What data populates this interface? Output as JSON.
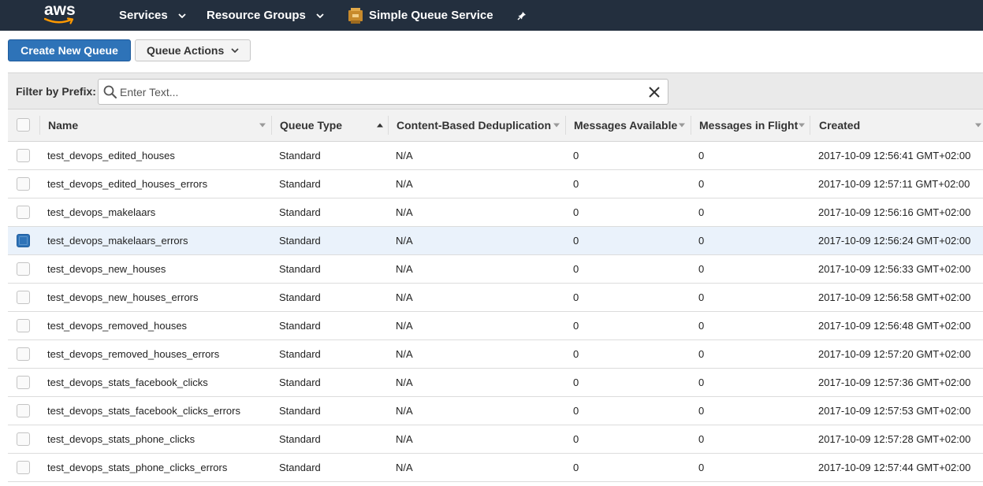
{
  "nav": {
    "logo": "aws",
    "services": "Services",
    "resource_groups": "Resource Groups",
    "service_name": "Simple Queue Service",
    "service_icon": "sqs-icon",
    "pin_icon": "pin-icon",
    "bg_color": "#232f3e"
  },
  "toolbar": {
    "create_label": "Create New Queue",
    "actions_label": "Queue Actions",
    "primary_color": "#2e73b8"
  },
  "filter": {
    "label": "Filter by Prefix:",
    "placeholder": "Enter Text...",
    "value": ""
  },
  "table": {
    "columns": [
      "Name",
      "Queue Type",
      "Content-Based Deduplication",
      "Messages Available",
      "Messages in Flight",
      "Created"
    ],
    "sorted_column": "Queue Type",
    "sort_direction": "ascending",
    "rows": [
      {
        "name": "test_devops_edited_houses",
        "type": "Standard",
        "dedup": "N/A",
        "available": "0",
        "in_flight": "0",
        "created": "2017-10-09 12:56:41 GMT+02:00",
        "selected": false
      },
      {
        "name": "test_devops_edited_houses_errors",
        "type": "Standard",
        "dedup": "N/A",
        "available": "0",
        "in_flight": "0",
        "created": "2017-10-09 12:57:11 GMT+02:00",
        "selected": false
      },
      {
        "name": "test_devops_makelaars",
        "type": "Standard",
        "dedup": "N/A",
        "available": "0",
        "in_flight": "0",
        "created": "2017-10-09 12:56:16 GMT+02:00",
        "selected": false
      },
      {
        "name": "test_devops_makelaars_errors",
        "type": "Standard",
        "dedup": "N/A",
        "available": "0",
        "in_flight": "0",
        "created": "2017-10-09 12:56:24 GMT+02:00",
        "selected": true
      },
      {
        "name": "test_devops_new_houses",
        "type": "Standard",
        "dedup": "N/A",
        "available": "0",
        "in_flight": "0",
        "created": "2017-10-09 12:56:33 GMT+02:00",
        "selected": false
      },
      {
        "name": "test_devops_new_houses_errors",
        "type": "Standard",
        "dedup": "N/A",
        "available": "0",
        "in_flight": "0",
        "created": "2017-10-09 12:56:58 GMT+02:00",
        "selected": false
      },
      {
        "name": "test_devops_removed_houses",
        "type": "Standard",
        "dedup": "N/A",
        "available": "0",
        "in_flight": "0",
        "created": "2017-10-09 12:56:48 GMT+02:00",
        "selected": false
      },
      {
        "name": "test_devops_removed_houses_errors",
        "type": "Standard",
        "dedup": "N/A",
        "available": "0",
        "in_flight": "0",
        "created": "2017-10-09 12:57:20 GMT+02:00",
        "selected": false
      },
      {
        "name": "test_devops_stats_facebook_clicks",
        "type": "Standard",
        "dedup": "N/A",
        "available": "0",
        "in_flight": "0",
        "created": "2017-10-09 12:57:36 GMT+02:00",
        "selected": false
      },
      {
        "name": "test_devops_stats_facebook_clicks_errors",
        "type": "Standard",
        "dedup": "N/A",
        "available": "0",
        "in_flight": "0",
        "created": "2017-10-09 12:57:53 GMT+02:00",
        "selected": false
      },
      {
        "name": "test_devops_stats_phone_clicks",
        "type": "Standard",
        "dedup": "N/A",
        "available": "0",
        "in_flight": "0",
        "created": "2017-10-09 12:57:28 GMT+02:00",
        "selected": false
      },
      {
        "name": "test_devops_stats_phone_clicks_errors",
        "type": "Standard",
        "dedup": "N/A",
        "available": "0",
        "in_flight": "0",
        "created": "2017-10-09 12:57:44 GMT+02:00",
        "selected": false
      }
    ]
  }
}
